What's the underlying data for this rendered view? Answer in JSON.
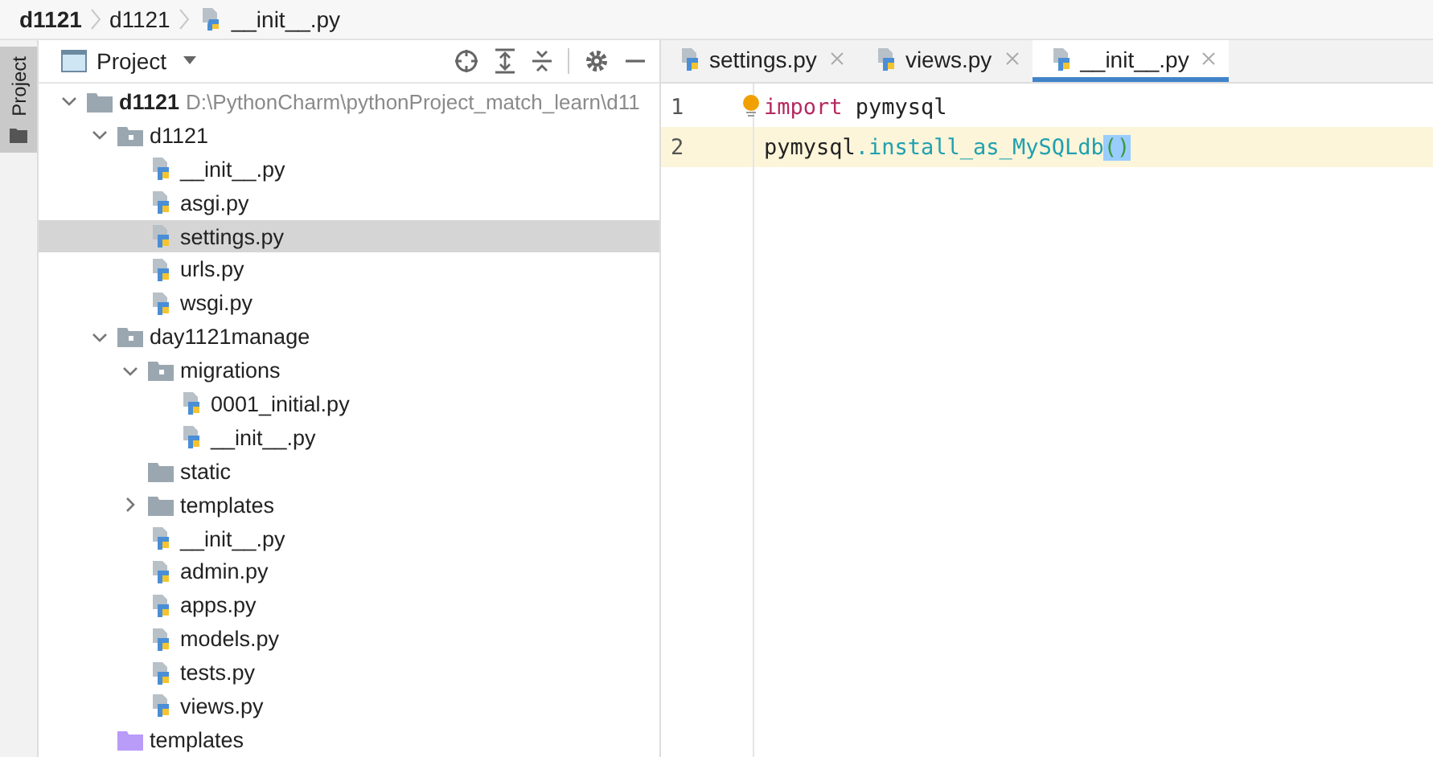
{
  "breadcrumb": [
    "d1121",
    "d1121",
    "__init__.py"
  ],
  "side_tab": {
    "label": "Project",
    "selected": true
  },
  "project_panel": {
    "title": "Project",
    "tree": [
      {
        "name": "d1121",
        "path": "D:\\PythonCharm\\pythonProject_match_learn\\d11",
        "kind": "root",
        "expanded": true,
        "selected": false,
        "children": [
          {
            "name": "d1121",
            "kind": "package",
            "expanded": true,
            "selected": false,
            "children": [
              {
                "name": "__init__.py",
                "kind": "file",
                "selected": false
              },
              {
                "name": "asgi.py",
                "kind": "file",
                "selected": false
              },
              {
                "name": "settings.py",
                "kind": "file",
                "selected": true
              },
              {
                "name": "urls.py",
                "kind": "file",
                "selected": false
              },
              {
                "name": "wsgi.py",
                "kind": "file",
                "selected": false
              }
            ]
          },
          {
            "name": "day1121manage",
            "kind": "package",
            "expanded": true,
            "selected": false,
            "children": [
              {
                "name": "migrations",
                "kind": "package",
                "expanded": true,
                "selected": false,
                "children": [
                  {
                    "name": "0001_initial.py",
                    "kind": "file",
                    "selected": false
                  },
                  {
                    "name": "__init__.py",
                    "kind": "file",
                    "selected": false
                  }
                ]
              },
              {
                "name": "static",
                "kind": "folder",
                "selected": false
              },
              {
                "name": "templates",
                "kind": "folder",
                "expanded": false,
                "selected": false
              },
              {
                "name": "__init__.py",
                "kind": "file",
                "selected": false
              },
              {
                "name": "admin.py",
                "kind": "file",
                "selected": false
              },
              {
                "name": "apps.py",
                "kind": "file",
                "selected": false
              },
              {
                "name": "models.py",
                "kind": "file",
                "selected": false
              },
              {
                "name": "tests.py",
                "kind": "file",
                "selected": false
              },
              {
                "name": "views.py",
                "kind": "file",
                "selected": false
              }
            ]
          },
          {
            "name": "templates",
            "kind": "template_folder",
            "selected": false
          }
        ]
      }
    ]
  },
  "tabs": [
    {
      "label": "settings.py",
      "selected": false
    },
    {
      "label": "views.py",
      "selected": false
    },
    {
      "label": "__init__.py",
      "selected": true
    }
  ],
  "editor": {
    "lines": [
      {
        "number": "1",
        "current": false,
        "tokens": [
          {
            "text": "import",
            "kind": "keyword"
          },
          {
            "text": " pymysql",
            "kind": "plain"
          }
        ]
      },
      {
        "number": "2",
        "current": true,
        "tokens": [
          {
            "text": "pymysql",
            "kind": "plain"
          },
          {
            "text": ".install_as_MySQLdb",
            "kind": "call"
          },
          {
            "text": "()",
            "kind": "paren_match"
          }
        ]
      }
    ]
  }
}
